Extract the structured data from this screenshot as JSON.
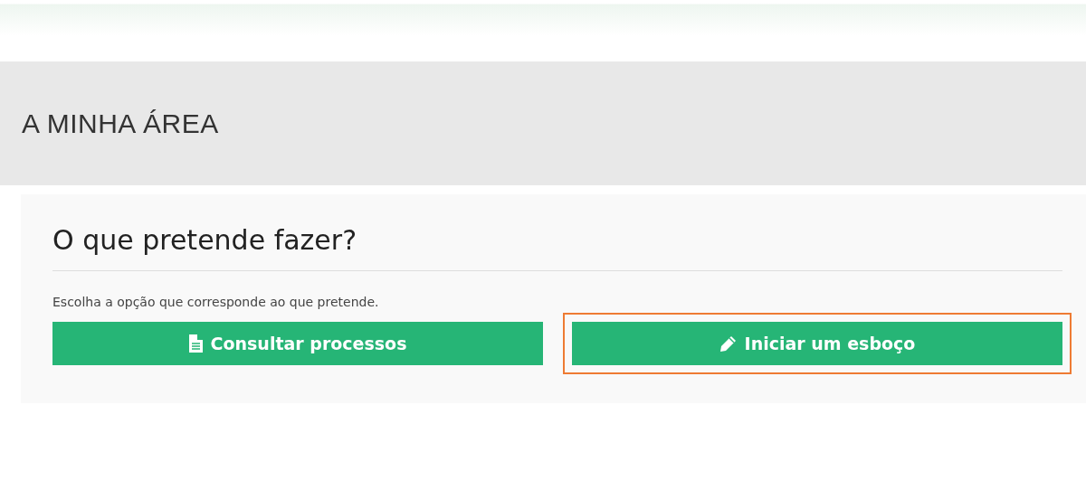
{
  "page_title": "A MINHA ÁREA",
  "card": {
    "heading": "O que pretende fazer?",
    "instruction": "Escolha a opção que corresponde ao que pretende.",
    "buttons": [
      {
        "label": "Consultar processos",
        "kind": "document",
        "highlighted": false
      },
      {
        "label": "Iniciar um esboço",
        "kind": "pencil",
        "highlighted": true
      }
    ]
  }
}
